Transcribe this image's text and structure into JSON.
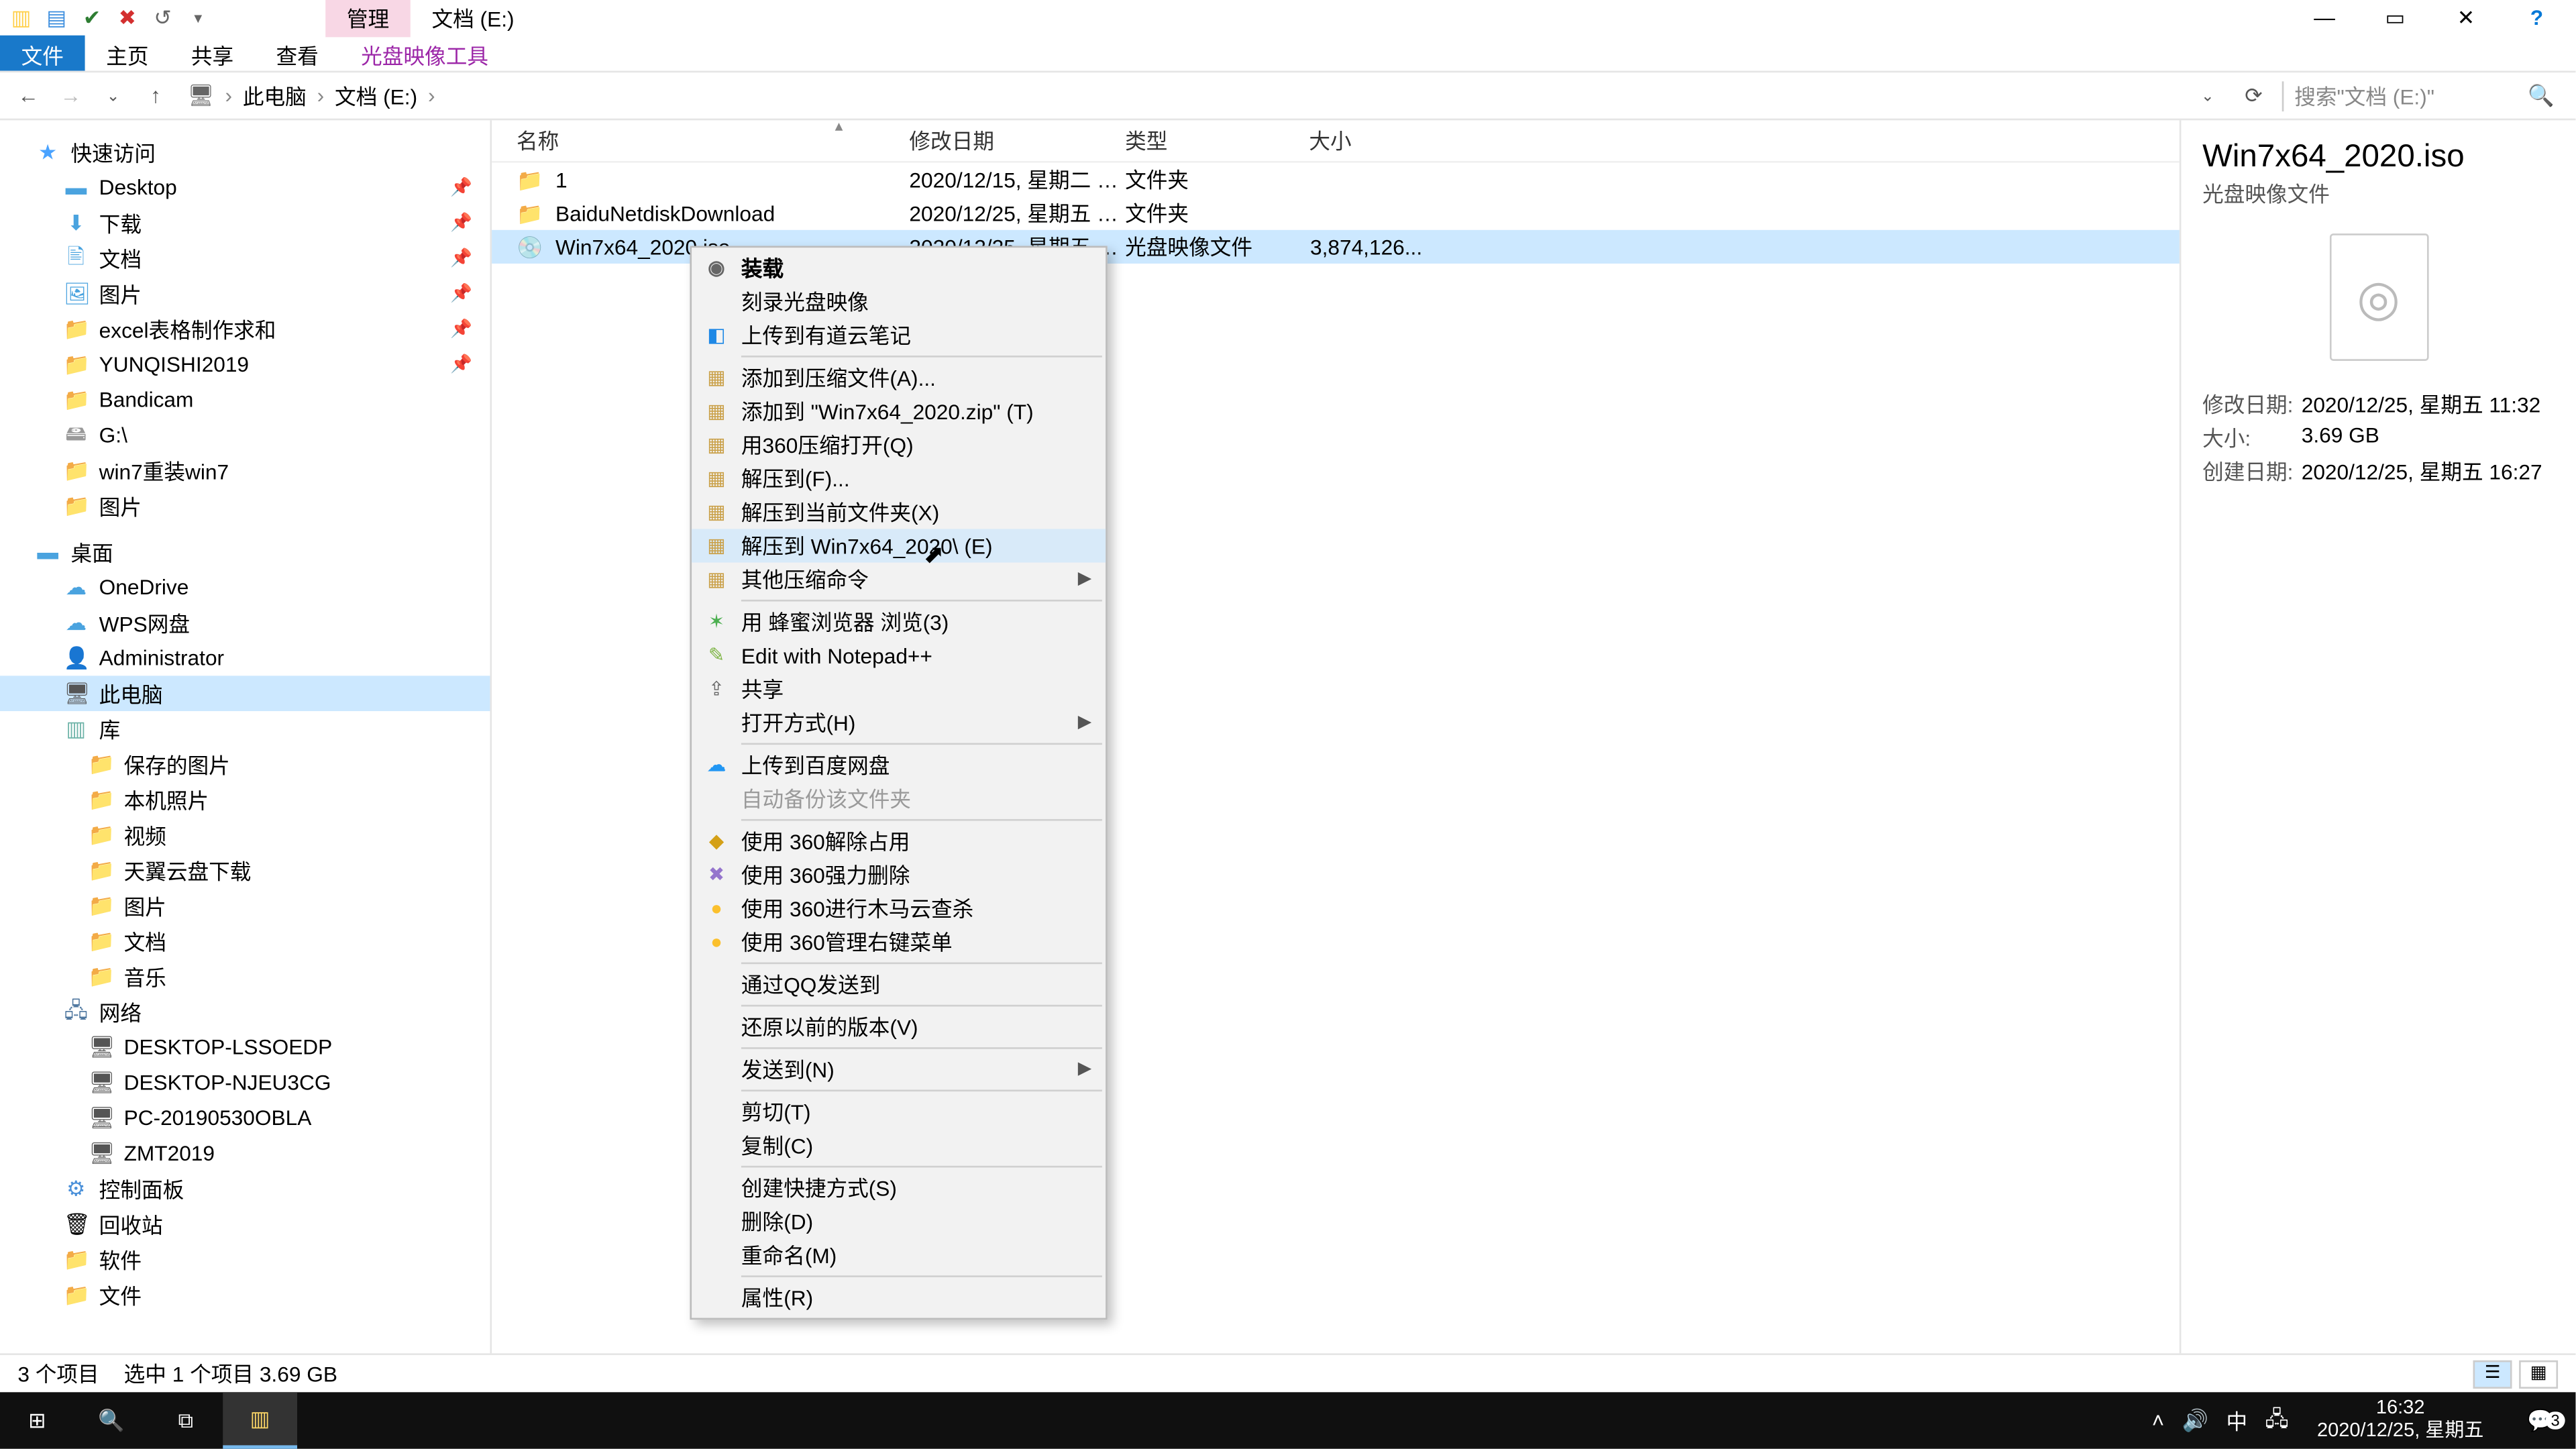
{
  "window": {
    "tab_manage": "管理",
    "tab_location": "文档 (E:)",
    "close": "✕",
    "max": "▭",
    "min": "—"
  },
  "ribbon": {
    "file": "文件",
    "home": "主页",
    "share": "共享",
    "view": "查看",
    "disc": "光盘映像工具"
  },
  "address": {
    "pc": "此电脑",
    "drive": "文档 (E:)",
    "search_placeholder": "搜索\"文档 (E:)\""
  },
  "tree": {
    "quick": "快速访问",
    "desktop": "Desktop",
    "downloads": "下载",
    "documents": "文档",
    "pictures": "图片",
    "excel": "excel表格制作求和",
    "yunqishi": "YUNQISHI2019",
    "bandicam": "Bandicam",
    "gdrive": "G:\\",
    "win7reinstall": "win7重装win7",
    "pictures2": "图片",
    "deskgroup": "桌面",
    "onedrive": "OneDrive",
    "wps": "WPS网盘",
    "admin": "Administrator",
    "thispc": "此电脑",
    "lib": "库",
    "saved_pics": "保存的图片",
    "local_pics": "本机照片",
    "video": "视频",
    "tianyi": "天翼云盘下载",
    "pics3": "图片",
    "docs2": "文档",
    "music": "音乐",
    "network": "网络",
    "d1": "DESKTOP-LSSOEDP",
    "d2": "DESKTOP-NJEU3CG",
    "d3": "PC-20190530OBLA",
    "d4": "ZMT2019",
    "cp": "控制面板",
    "recycle": "回收站",
    "software": "软件",
    "files": "文件"
  },
  "columns": {
    "name": "名称",
    "date": "修改日期",
    "type": "类型",
    "size": "大小"
  },
  "files": [
    {
      "icon": "📁",
      "name": "1",
      "date": "2020/12/15, 星期二 1...",
      "type": "文件夹",
      "size": ""
    },
    {
      "icon": "📁",
      "name": "BaiduNetdiskDownload",
      "date": "2020/12/25, 星期五 1...",
      "type": "文件夹",
      "size": ""
    },
    {
      "icon": "💿",
      "name": "Win7x64_2020.iso",
      "date": "2020/12/25, 星期五 1...",
      "type": "光盘映像文件",
      "size": "3,874,126..."
    }
  ],
  "details": {
    "title": "Win7x64_2020.iso",
    "subtitle": "光盘映像文件",
    "mod_label": "修改日期:",
    "mod_val": "2020/12/25, 星期五 11:32",
    "size_label": "大小:",
    "size_val": "3.69 GB",
    "create_label": "创建日期:",
    "create_val": "2020/12/25, 星期五 16:27"
  },
  "context_menu": [
    {
      "type": "item",
      "label": "装载",
      "bold": true,
      "icon": "◉"
    },
    {
      "type": "item",
      "label": "刻录光盘映像"
    },
    {
      "type": "item",
      "label": "上传到有道云笔记",
      "icon": "◧",
      "icon_color": "#1e88e5"
    },
    {
      "type": "sep"
    },
    {
      "type": "item",
      "label": "添加到压缩文件(A)...",
      "icon": "▦",
      "icon_color": "#caa14a"
    },
    {
      "type": "item",
      "label": "添加到 \"Win7x64_2020.zip\" (T)",
      "icon": "▦",
      "icon_color": "#caa14a"
    },
    {
      "type": "item",
      "label": "用360压缩打开(Q)",
      "icon": "▦",
      "icon_color": "#caa14a"
    },
    {
      "type": "item",
      "label": "解压到(F)...",
      "icon": "▦",
      "icon_color": "#caa14a"
    },
    {
      "type": "item",
      "label": "解压到当前文件夹(X)",
      "icon": "▦",
      "icon_color": "#caa14a"
    },
    {
      "type": "item",
      "label": "解压到 Win7x64_2020\\ (E)",
      "icon": "▦",
      "icon_color": "#caa14a",
      "highlight": true
    },
    {
      "type": "item",
      "label": "其他压缩命令",
      "icon": "▦",
      "icon_color": "#caa14a",
      "submenu": true
    },
    {
      "type": "sep"
    },
    {
      "type": "item",
      "label": "用 蜂蜜浏览器 浏览(3)",
      "icon": "✶",
      "icon_color": "#4caf50"
    },
    {
      "type": "item",
      "label": "Edit with Notepad++",
      "icon": "✎",
      "icon_color": "#7cb342"
    },
    {
      "type": "item",
      "label": "共享",
      "icon": "⇪"
    },
    {
      "type": "item",
      "label": "打开方式(H)",
      "submenu": true
    },
    {
      "type": "sep"
    },
    {
      "type": "item",
      "label": "上传到百度网盘",
      "icon": "☁",
      "icon_color": "#2196f3"
    },
    {
      "type": "item",
      "label": "自动备份该文件夹",
      "disabled": true
    },
    {
      "type": "sep"
    },
    {
      "type": "item",
      "label": "使用 360解除占用",
      "icon": "◆",
      "icon_color": "#d4a017"
    },
    {
      "type": "item",
      "label": "使用 360强力删除",
      "icon": "✖",
      "icon_color": "#9575cd"
    },
    {
      "type": "item",
      "label": "使用 360进行木马云查杀",
      "icon": "●",
      "icon_color": "#fbc02d"
    },
    {
      "type": "item",
      "label": "使用 360管理右键菜单",
      "icon": "●",
      "icon_color": "#fbc02d"
    },
    {
      "type": "sep"
    },
    {
      "type": "item",
      "label": "通过QQ发送到"
    },
    {
      "type": "sep"
    },
    {
      "type": "item",
      "label": "还原以前的版本(V)"
    },
    {
      "type": "sep"
    },
    {
      "type": "item",
      "label": "发送到(N)",
      "submenu": true
    },
    {
      "type": "sep"
    },
    {
      "type": "item",
      "label": "剪切(T)"
    },
    {
      "type": "item",
      "label": "复制(C)"
    },
    {
      "type": "sep"
    },
    {
      "type": "item",
      "label": "创建快捷方式(S)"
    },
    {
      "type": "item",
      "label": "删除(D)"
    },
    {
      "type": "item",
      "label": "重命名(M)"
    },
    {
      "type": "sep"
    },
    {
      "type": "item",
      "label": "属性(R)"
    }
  ],
  "status": {
    "items": "3 个项目",
    "selection": "选中 1 个项目  3.69 GB"
  },
  "taskbar": {
    "ime": "中",
    "time": "16:32",
    "date": "2020/12/25, 星期五",
    "notif_count": "3"
  }
}
